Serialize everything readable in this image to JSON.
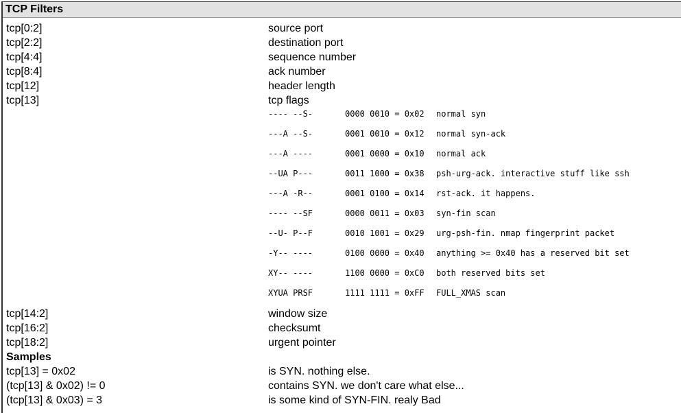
{
  "title": "TCP Filters",
  "fields": [
    {
      "expr": "tcp[0:2]",
      "desc": "source port"
    },
    {
      "expr": "tcp[2:2]",
      "desc": "destination port"
    },
    {
      "expr": "tcp[4:4]",
      "desc": "sequence number"
    },
    {
      "expr": "tcp[8:4]",
      "desc": "ack number"
    },
    {
      "expr": "tcp[12]",
      "desc": "header length"
    },
    {
      "expr": "tcp[13]",
      "desc": "tcp flags"
    }
  ],
  "flags": [
    {
      "pattern": "---- --S-",
      "binary": "0000 0010 = 0x02",
      "desc": "normal syn"
    },
    {
      "pattern": "---A --S-",
      "binary": "0001 0010 = 0x12",
      "desc": "normal syn-ack"
    },
    {
      "pattern": "---A ----",
      "binary": "0001 0000 = 0x10",
      "desc": "normal ack"
    },
    {
      "pattern": "--UA P---",
      "binary": "0011 1000 = 0x38",
      "desc": "psh-urg-ack. interactive stuff like ssh"
    },
    {
      "pattern": "---A -R--",
      "binary": "0001 0100 = 0x14",
      "desc": "rst-ack. it happens."
    },
    {
      "pattern": "---- --SF",
      "binary": "0000 0011 = 0x03",
      "desc": "syn-fin scan"
    },
    {
      "pattern": "--U- P--F",
      "binary": "0010 1001 = 0x29",
      "desc": "urg-psh-fin. nmap fingerprint packet"
    },
    {
      "pattern": "-Y-- ----",
      "binary": "0100 0000 = 0x40",
      "desc": "anything >= 0x40 has a reserved bit set"
    },
    {
      "pattern": "XY-- ----",
      "binary": "1100 0000 = 0xC0",
      "desc": "both reserved bits set"
    },
    {
      "pattern": "XYUA PRSF",
      "binary": "1111 1111 = 0xFF",
      "desc": "FULL_XMAS scan"
    }
  ],
  "fields2": [
    {
      "expr": "tcp[14:2]",
      "desc": "window size"
    },
    {
      "expr": "tcp[16:2]",
      "desc": "checksumt"
    },
    {
      "expr": "tcp[18:2]",
      "desc": "urgent pointer"
    }
  ],
  "samples_heading": "Samples",
  "samples": [
    {
      "expr": "tcp[13] = 0x02",
      "desc": "is SYN. nothing else."
    },
    {
      "expr": "(tcp[13] & 0x02) != 0",
      "desc": "contains SYN. we don't care what else..."
    },
    {
      "expr": "(tcp[13] & 0x03) = 3",
      "desc": "is some kind of SYN-FIN. realy Bad"
    }
  ]
}
